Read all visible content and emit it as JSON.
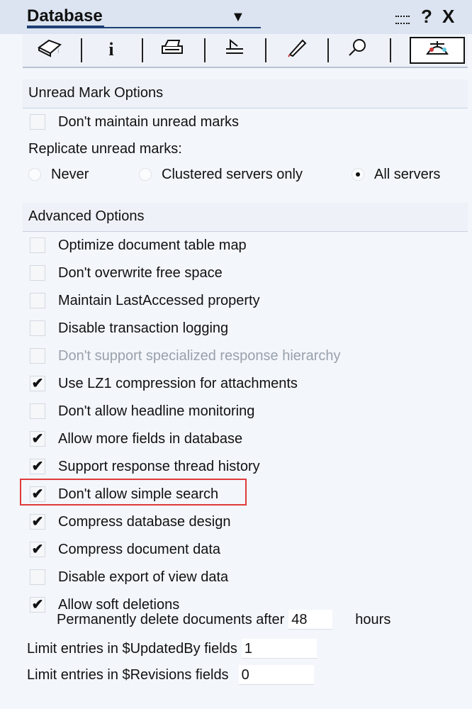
{
  "titlebar": {
    "title": "Database",
    "dropdown_icon": "triangle-down-icon",
    "minimize_icon": "minimize-icon",
    "help": "?",
    "close": "X"
  },
  "tabs": [
    {
      "name": "basics-tab",
      "icon": "database-icon",
      "glyph": "⬭"
    },
    {
      "name": "info-tab",
      "icon": "info-icon",
      "glyph": "i"
    },
    {
      "name": "printing-tab",
      "icon": "printer-icon",
      "glyph": "⎙"
    },
    {
      "name": "design-tab",
      "icon": "tools-icon",
      "glyph": "⌂"
    },
    {
      "name": "launch-tab",
      "icon": "rocket-icon",
      "glyph": "✎"
    },
    {
      "name": "fulltext-tab",
      "icon": "magnifier-icon",
      "glyph": "⚲"
    },
    {
      "name": "advanced-tab",
      "icon": "propeller-hat-icon",
      "glyph": "⛸",
      "active": true
    }
  ],
  "unread": {
    "header": "Unread Mark Options",
    "dont_maintain": {
      "label": "Don't maintain unread marks",
      "checked": false
    },
    "replicate_label": "Replicate unread marks:",
    "replicate_options": [
      {
        "label": "Never",
        "selected": false
      },
      {
        "label": "Clustered servers only",
        "selected": false
      },
      {
        "label": "All servers",
        "selected": true
      }
    ]
  },
  "advanced": {
    "header": "Advanced Options",
    "options": [
      {
        "label": "Optimize document table map",
        "checked": false,
        "disabled": false
      },
      {
        "label": "Don't overwrite free space",
        "checked": false,
        "disabled": false
      },
      {
        "label": "Maintain LastAccessed property",
        "checked": false,
        "disabled": false
      },
      {
        "label": "Disable transaction logging",
        "checked": false,
        "disabled": false
      },
      {
        "label": "Don't support specialized response hierarchy",
        "checked": false,
        "disabled": true
      },
      {
        "label": "Use LZ1 compression for attachments",
        "checked": true,
        "disabled": false
      },
      {
        "label": "Don't allow headline monitoring",
        "checked": false,
        "disabled": false
      },
      {
        "label": "Allow more fields in database",
        "checked": true,
        "disabled": false
      },
      {
        "label": "Support response thread history",
        "checked": true,
        "disabled": false
      },
      {
        "label": "Don't allow simple search",
        "checked": true,
        "disabled": false
      },
      {
        "label": "Compress database design",
        "checked": true,
        "disabled": false
      },
      {
        "label": "Compress document data",
        "checked": true,
        "disabled": false
      },
      {
        "label": "Disable export of view data",
        "checked": false,
        "disabled": false
      },
      {
        "label": "Allow soft deletions",
        "checked": true,
        "disabled": false
      }
    ],
    "soft_delete": {
      "prefix": "Permanently delete documents after",
      "value": "48",
      "suffix": "hours"
    },
    "updatedby": {
      "label": "Limit entries in $UpdatedBy fields",
      "value": "1"
    },
    "revisions": {
      "label": "Limit entries in $Revisions fields",
      "value": "0"
    }
  },
  "colors": {
    "highlight": "#e03a3a",
    "accent": "#1f3f75"
  }
}
